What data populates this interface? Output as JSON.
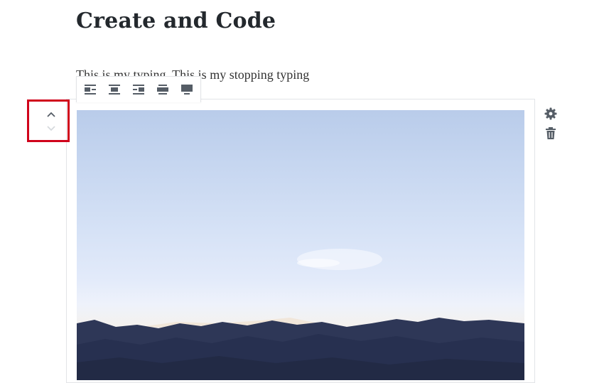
{
  "post": {
    "title": "Create and Code",
    "paragraph": "This is my typing. This is my stopping typing"
  },
  "image_toolbar": {
    "buttons": [
      "align-left-icon",
      "align-center-icon",
      "align-right-icon",
      "wide-width-icon",
      "full-width-icon"
    ]
  },
  "block_mover": {
    "up_icon": "chevron-up-icon",
    "down_icon": "chevron-down-icon"
  },
  "block_side_tools": {
    "settings_icon": "gear-icon",
    "delete_icon": "trash-icon"
  },
  "colors": {
    "highlight_border": "#d0021b",
    "icon": "#555d66",
    "sky_top": "#b9ccea",
    "mountains": "#2c3554"
  }
}
